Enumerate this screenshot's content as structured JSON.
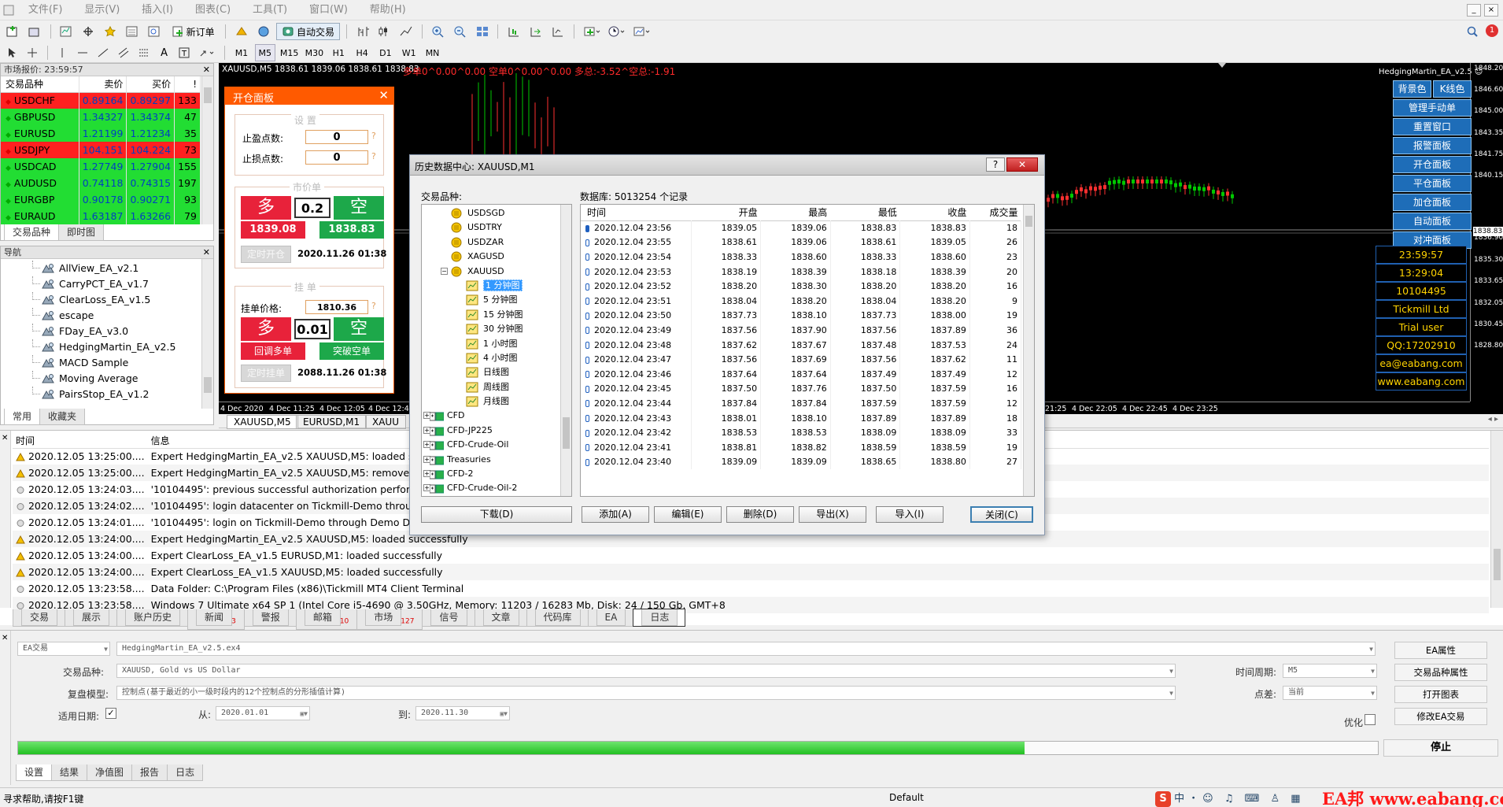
{
  "menu": [
    "文件(F)",
    "显示(V)",
    "插入(I)",
    "图表(C)",
    "工具(T)",
    "窗口(W)",
    "帮助(H)"
  ],
  "toolbar": {
    "new_order": "新订单",
    "auto_trading": "自动交易",
    "timeframes": [
      "M1",
      "M5",
      "M15",
      "M30",
      "H1",
      "H4",
      "D1",
      "W1",
      "MN"
    ]
  },
  "market_watch": {
    "title": "市场报价: 23:59:57",
    "headers": [
      "交易品种",
      "卖价",
      "买价",
      "!"
    ],
    "rows": [
      {
        "symbol": "USDCHF",
        "bid": "0.89164",
        "ask": "0.89297",
        "spread": "133",
        "dir": "down"
      },
      {
        "symbol": "GBPUSD",
        "bid": "1.34327",
        "ask": "1.34374",
        "spread": "47",
        "dir": "up"
      },
      {
        "symbol": "EURUSD",
        "bid": "1.21199",
        "ask": "1.21234",
        "spread": "35",
        "dir": "up"
      },
      {
        "symbol": "USDJPY",
        "bid": "104.151",
        "ask": "104.224",
        "spread": "73",
        "dir": "down"
      },
      {
        "symbol": "USDCAD",
        "bid": "1.27749",
        "ask": "1.27904",
        "spread": "155",
        "dir": "up"
      },
      {
        "symbol": "AUDUSD",
        "bid": "0.74118",
        "ask": "0.74315",
        "spread": "197",
        "dir": "up"
      },
      {
        "symbol": "EURGBP",
        "bid": "0.90178",
        "ask": "0.90271",
        "spread": "93",
        "dir": "up"
      },
      {
        "symbol": "EURAUD",
        "bid": "1.63187",
        "ask": "1.63266",
        "spread": "79",
        "dir": "up"
      }
    ],
    "tabs": [
      "交易品种",
      "即时图"
    ]
  },
  "navigator": {
    "title": "导航",
    "items": [
      "AllView_EA_v2.1",
      "CarryPCT_EA_v1.7",
      "ClearLoss_EA_v1.5",
      "escape",
      "FDay_EA_v3.0",
      "HedgingMartin_EA_v2.5",
      "MACD Sample",
      "Moving Average",
      "PairsStop_EA_v1.2"
    ],
    "tabs": [
      "常用",
      "收藏夹"
    ]
  },
  "chart": {
    "title": "XAUUSD,M5  1838.61 1839.06 1838.61 1838.83",
    "stats": "多单0^0.00^0.00  空单0^0.00^0.00  多总:-3.52^空总:-1.91",
    "ea_name": "HedgingMartin_EA_v2.5",
    "price_labels": [
      "1848.20",
      "1846.60",
      "1845.00",
      "1843.35",
      "1841.75",
      "1840.15",
      "1838.83",
      "1836.90",
      "1835.30",
      "1833.65",
      "1832.05",
      "1830.45",
      "1828.80"
    ],
    "time_labels_left": [
      "4 Dec 2020",
      "4 Dec 11:25",
      "4 Dec 12:05",
      "4 Dec 12:45"
    ],
    "time_labels_right": [
      "21:25",
      "4 Dec 22:05",
      "4 Dec 22:45",
      "4 Dec 23:25"
    ],
    "chart_tabs": [
      "XAUUSD,M5",
      "EURUSD,M1",
      "XAUU"
    ],
    "ea_buttons": [
      "背景色",
      "K线色",
      "管理手动单",
      "重置窗口",
      "报警面板",
      "开仓面板",
      "平仓面板",
      "加仓面板",
      "自动面板",
      "对冲面板"
    ],
    "info": [
      "23:59:57",
      "13:29:04",
      "10104495",
      "Tickmill Ltd",
      "Trial user",
      "QQ:17202910",
      "ea@eabang.com",
      "www.eabang.com"
    ]
  },
  "open_panel": {
    "title": "开仓面板",
    "settings": "设   置",
    "tp_label": "止盈点数:",
    "tp_value": "0",
    "sl_label": "止损点数:",
    "sl_value": "0",
    "market_section": "市价单",
    "buy": "多",
    "sell": "空",
    "lot": "0.2",
    "buy_price": "1839.08",
    "sell_price": "1838.83",
    "timed_open": "定时开仓",
    "timed_open_time": "2020.11.26 01:38",
    "pending_section": "挂   单",
    "pending_price_label": "挂单价格:",
    "pending_price": "1810.36",
    "pending_lot": "0.01",
    "callback_buy": "回调多单",
    "breakout_sell": "突破空单",
    "timed_pending": "定时挂单",
    "timed_pending_time": "2088.11.26 01:38"
  },
  "history_dialog": {
    "title": "历史数据中心: XAUUSD,M1",
    "symbols_label": "交易品种:",
    "db_label": "数据库: 5013254 个记录",
    "tree": [
      {
        "label": "USDSGD",
        "level": 2
      },
      {
        "label": "USDTRY",
        "level": 2
      },
      {
        "label": "USDZAR",
        "level": 2
      },
      {
        "label": "XAGUSD",
        "level": 2
      },
      {
        "label": "XAUUSD",
        "level": 2,
        "expanded": true
      },
      {
        "label": "1 分钟图",
        "level": 3,
        "selected": true
      },
      {
        "label": "5 分钟图",
        "level": 3
      },
      {
        "label": "15 分钟图",
        "level": 3
      },
      {
        "label": "30 分钟图",
        "level": 3
      },
      {
        "label": "1 小时图",
        "level": 3
      },
      {
        "label": "4 小时图",
        "level": 3
      },
      {
        "label": "日线图",
        "level": 3
      },
      {
        "label": "周线图",
        "level": 3
      },
      {
        "label": "月线图",
        "level": 3
      },
      {
        "label": "CFD",
        "level": 1
      },
      {
        "label": "CFD-JP225",
        "level": 1
      },
      {
        "label": "CFD-Crude-Oil",
        "level": 1
      },
      {
        "label": "Treasuries",
        "level": 1
      },
      {
        "label": "CFD-2",
        "level": 1
      },
      {
        "label": "CFD-Crude-Oil-2",
        "level": 1
      }
    ],
    "headers": [
      "时间",
      "开盘",
      "最高",
      "最低",
      "收盘",
      "成交量"
    ],
    "rows": [
      [
        "2020.12.04 23:56",
        "1839.05",
        "1839.06",
        "1838.83",
        "1838.83",
        "18"
      ],
      [
        "2020.12.04 23:55",
        "1838.61",
        "1839.06",
        "1838.61",
        "1839.05",
        "26"
      ],
      [
        "2020.12.04 23:54",
        "1838.33",
        "1838.60",
        "1838.33",
        "1838.60",
        "23"
      ],
      [
        "2020.12.04 23:53",
        "1838.19",
        "1838.39",
        "1838.18",
        "1838.39",
        "20"
      ],
      [
        "2020.12.04 23:52",
        "1838.20",
        "1838.30",
        "1838.20",
        "1838.20",
        "16"
      ],
      [
        "2020.12.04 23:51",
        "1838.04",
        "1838.20",
        "1838.04",
        "1838.20",
        "9"
      ],
      [
        "2020.12.04 23:50",
        "1837.73",
        "1838.10",
        "1837.73",
        "1838.00",
        "19"
      ],
      [
        "2020.12.04 23:49",
        "1837.56",
        "1837.90",
        "1837.56",
        "1837.89",
        "36"
      ],
      [
        "2020.12.04 23:48",
        "1837.62",
        "1837.67",
        "1837.48",
        "1837.53",
        "24"
      ],
      [
        "2020.12.04 23:47",
        "1837.56",
        "1837.69",
        "1837.56",
        "1837.62",
        "11"
      ],
      [
        "2020.12.04 23:46",
        "1837.64",
        "1837.64",
        "1837.49",
        "1837.49",
        "12"
      ],
      [
        "2020.12.04 23:45",
        "1837.50",
        "1837.76",
        "1837.50",
        "1837.59",
        "16"
      ],
      [
        "2020.12.04 23:44",
        "1837.84",
        "1837.84",
        "1837.59",
        "1837.59",
        "12"
      ],
      [
        "2020.12.04 23:43",
        "1838.01",
        "1838.10",
        "1837.89",
        "1837.89",
        "18"
      ],
      [
        "2020.12.04 23:42",
        "1838.53",
        "1838.53",
        "1838.09",
        "1838.09",
        "33"
      ],
      [
        "2020.12.04 23:41",
        "1838.81",
        "1838.82",
        "1838.59",
        "1838.59",
        "19"
      ],
      [
        "2020.12.04 23:40",
        "1839.09",
        "1839.09",
        "1838.65",
        "1838.80",
        "27"
      ]
    ],
    "buttons": {
      "download": "下载(D)",
      "add": "添加(A)",
      "edit": "编辑(E)",
      "delete": "删除(D)",
      "export": "导出(X)",
      "import": "导入(I)",
      "close": "关闭(C)"
    }
  },
  "log": {
    "headers": [
      "时间",
      "信息"
    ],
    "rows": [
      {
        "icon": "warn",
        "time": "2020.12.05 13:25:00....",
        "msg": "Expert HedgingMartin_EA_v2.5 XAUUSD,M5: loaded succe"
      },
      {
        "icon": "warn",
        "time": "2020.12.05 13:25:00....",
        "msg": "Expert HedgingMartin_EA_v2.5 XAUUSD,M5: removed"
      },
      {
        "icon": "info",
        "time": "2020.12.05 13:24:03....",
        "msg": "'10104495': previous successful authorization performed fr"
      },
      {
        "icon": "info",
        "time": "2020.12.05 13:24:02....",
        "msg": "'10104495': login datacenter on Tickmill-Demo through De"
      },
      {
        "icon": "info",
        "time": "2020.12.05 13:24:01....",
        "msg": "'10104495': login on Tickmill-Demo through Demo DC - Fr"
      },
      {
        "icon": "warn",
        "time": "2020.12.05 13:24:00....",
        "msg": "Expert HedgingMartin_EA_v2.5 XAUUSD,M5: loaded successfully"
      },
      {
        "icon": "warn",
        "time": "2020.12.05 13:24:00....",
        "msg": "Expert ClearLoss_EA_v1.5 EURUSD,M1: loaded successfully"
      },
      {
        "icon": "warn",
        "time": "2020.12.05 13:24:00....",
        "msg": "Expert ClearLoss_EA_v1.5 XAUUSD,M5: loaded successfully"
      },
      {
        "icon": "info",
        "time": "2020.12.05 13:23:58....",
        "msg": "Data Folder: C:\\Program Files (x86)\\Tickmill MT4 Client Terminal"
      },
      {
        "icon": "info",
        "time": "2020.12.05 13:23:58....",
        "msg": "Windows 7 Ultimate x64 SP 1 (Intel Core i5-4690 @ 3.50GHz, Memory: 11203 / 16283 Mb, Disk: 24 / 150 Gb, GMT+8"
      }
    ]
  },
  "terminal_tabs": [
    {
      "label": "交易"
    },
    {
      "label": "展示"
    },
    {
      "label": "账户历史"
    },
    {
      "label": "新闻",
      "badge": "3"
    },
    {
      "label": "警报"
    },
    {
      "label": "邮箱",
      "badge": "10"
    },
    {
      "label": "市场",
      "badge": "127"
    },
    {
      "label": "信号"
    },
    {
      "label": "文章"
    },
    {
      "label": "代码库"
    },
    {
      "label": "EA"
    },
    {
      "label": "日志",
      "active": true
    }
  ],
  "tester": {
    "mode": "EA交易",
    "expert": "HedgingMartin_EA_v2.5.ex4",
    "symbol_label": "交易品种:",
    "symbol": "XAUUSD, Gold vs US Dollar",
    "model_label": "复盘模型:",
    "model": "控制点(基于最近的小一级时段内的12个控制点的分形插值计算)",
    "date_label": "适用日期:",
    "from_label": "从:",
    "from": "2020.01.01",
    "to_label": "到:",
    "to": "2020.11.30",
    "period_label": "时间周期:",
    "period": "M5",
    "spread_label": "点差:",
    "spread": "当前",
    "optimize_label": "优化",
    "progress": 0.74,
    "buttons": [
      "EA属性",
      "交易品种属性",
      "打开图表",
      "修改EA交易"
    ],
    "stop": "停止",
    "tabs": [
      "设置",
      "结果",
      "净值图",
      "报告",
      "日志"
    ]
  },
  "status": {
    "help": "寻求帮助,请按F1键",
    "profile": "Default",
    "watermark": "EA邦 www.eabang.com"
  },
  "colors": {
    "bid_up_bg": "#22dd33",
    "bid_down_bg": "#ff2020",
    "panel_orange": "#ff5a00",
    "ea_button_blue": "#1e6db8",
    "bull_candle": "#00c800",
    "bear_candle": "#ff3030"
  }
}
